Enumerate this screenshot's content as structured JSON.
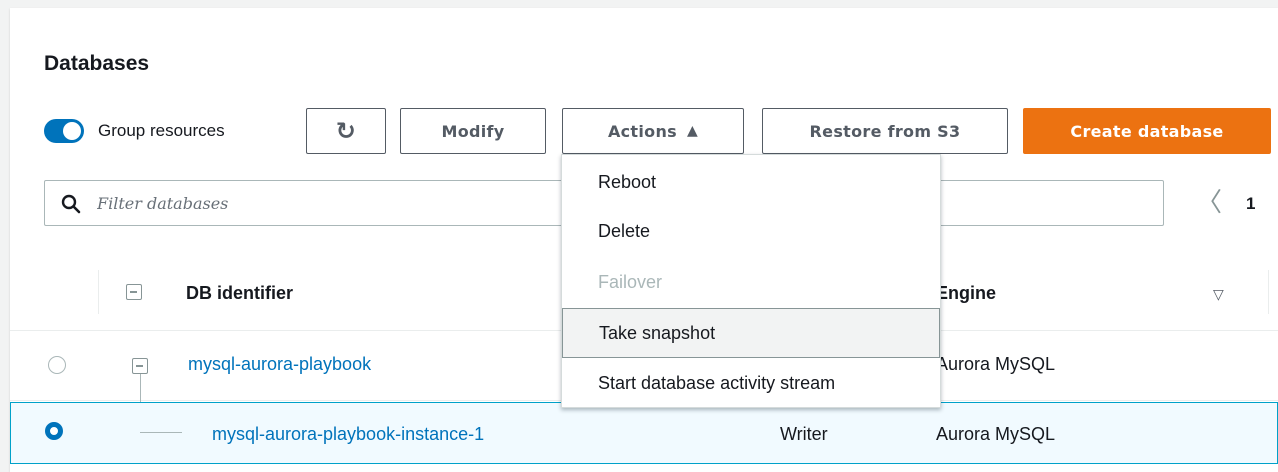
{
  "panel": {
    "title": "Databases"
  },
  "toolbar": {
    "group_resources_label": "Group resources",
    "refresh_glyph": "↻",
    "modify_label": "Modify",
    "actions_label": "Actions",
    "actions_caret": "▲",
    "restore_label": "Restore from S3",
    "create_label": "Create database",
    "group_resources_enabled": true,
    "accent_color": "#0073bb",
    "primary_color": "#ec7211"
  },
  "filter": {
    "placeholder": "Filter databases"
  },
  "pagination": {
    "prev_glyph": "〈",
    "current_page": "1"
  },
  "table": {
    "columns": {
      "identifier": "DB identifier",
      "engine": "Engine"
    },
    "rows": [
      {
        "identifier": "mysql-aurora-playbook",
        "role": "",
        "engine": "Aurora MySQL",
        "selected": false
      },
      {
        "identifier": "mysql-aurora-playbook-instance-1",
        "role": "Writer",
        "engine": "Aurora MySQL",
        "selected": true
      }
    ]
  },
  "actions_menu": {
    "items": [
      {
        "label": "Reboot",
        "disabled": false
      },
      {
        "label": "Delete",
        "disabled": false
      },
      {
        "label": "Failover",
        "disabled": true
      },
      {
        "label": "Take snapshot",
        "disabled": false,
        "highlighted": true
      },
      {
        "label": "Start database activity stream",
        "disabled": false
      }
    ]
  }
}
